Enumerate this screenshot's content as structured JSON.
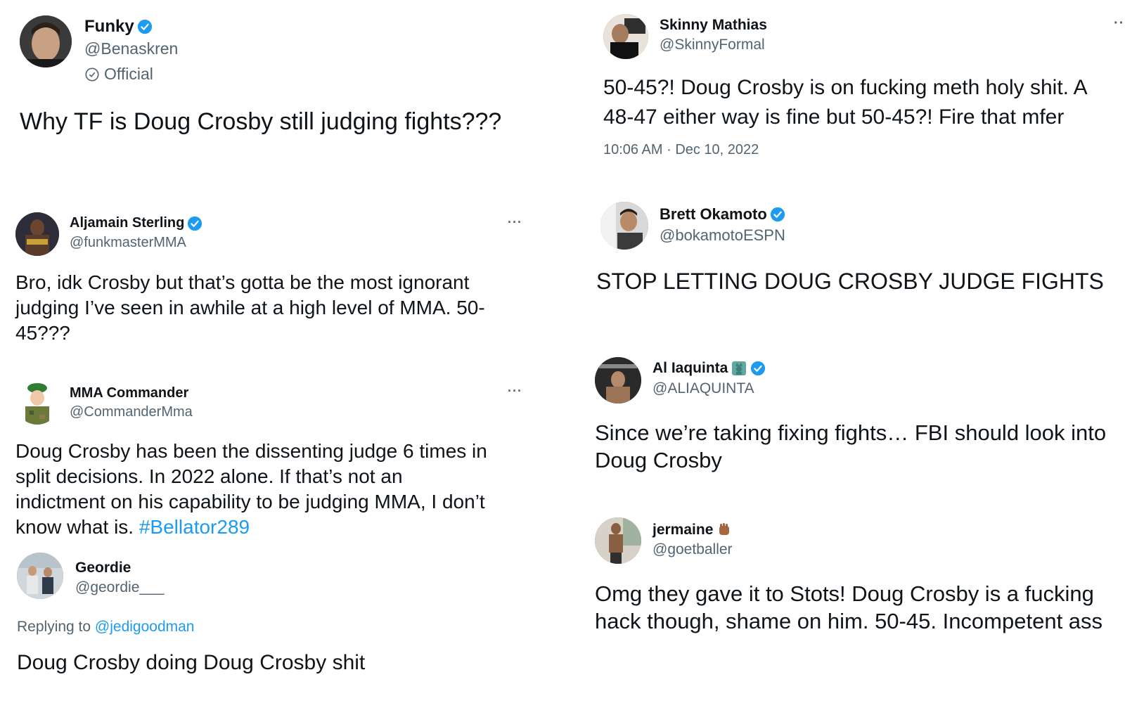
{
  "tweets": {
    "funky": {
      "name": "Funky",
      "handle": "@Benaskren",
      "label": "Official",
      "text": "Why TF is Doug Crosby still judging fights???"
    },
    "skinny": {
      "name": "Skinny Mathias",
      "handle": "@SkinnyFormal",
      "text_line1": "50-45?! Doug Crosby is on fucking meth holy shit. A",
      "text_line2": "48-47 either way is fine but 50-45?! Fire that mfer",
      "time": "10:06 AM",
      "sep": "·",
      "date": "Dec 10, 2022",
      "more": "··"
    },
    "aljamain": {
      "name": "Aljamain Sterling",
      "handle": "@funkmasterMMA",
      "more": "···",
      "text_line1": "Bro, idk Crosby but that’s gotta be the most ignorant",
      "text_line2": "judging I’ve seen in awhile at a high level of MMA. 50-",
      "text_line3": "45???"
    },
    "brett": {
      "name": "Brett Okamoto",
      "handle": "@bokamotoESPN",
      "text": "STOP LETTING DOUG CROSBY JUDGE FIGHTS"
    },
    "commander": {
      "name": "MMA Commander",
      "handle": "@CommanderMma",
      "more": "···",
      "text_line1": "Doug Crosby has been the dissenting judge 6 times in",
      "text_line2": "split decisions. In 2022 alone. If that’s not an",
      "text_line3": "indictment on his capability to be judging MMA, I don’t",
      "text_line4_prefix": "know what is.",
      "hashtag": "#Bellator289"
    },
    "iaquinta": {
      "name": "Al Iaquinta",
      "handle": "@ALIAQUINTA",
      "text_line1": "Since we’re taking fixing fights… FBI should look into",
      "text_line2": "Doug Crosby"
    },
    "geordie": {
      "name": "Geordie",
      "handle": "@geordie___",
      "replying_prefix": "Replying to",
      "replying_to": "@jedigoodman",
      "text": "Doug Crosby doing Doug Crosby shit"
    },
    "jermaine": {
      "name": "jermaine",
      "handle": "@goetballer",
      "text_line1": "Omg they gave it to Stots! Doug Crosby is a fucking",
      "text_line2": "hack though, shame on him. 50-45. Incompetent ass"
    }
  },
  "colors": {
    "link": "#1d9bf0",
    "secondary": "#536471",
    "verified": "#1d9bf0"
  }
}
